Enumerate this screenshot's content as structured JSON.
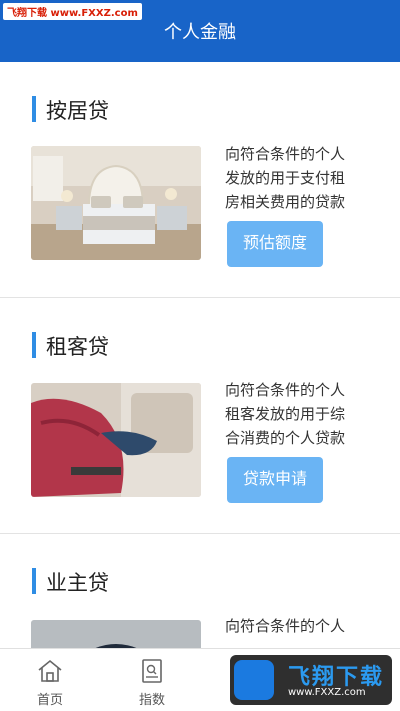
{
  "watermark": {
    "top_text": "飞翔下载 www.FXXZ.com",
    "bottom_name": "飞翔下载",
    "bottom_url": "www.FXXZ.com"
  },
  "header": {
    "title": "个人金融"
  },
  "sections": [
    {
      "title": "按居贷",
      "description_lines": [
        "向符合条件的个人",
        "发放的用于支付租",
        "房相关费用的贷款"
      ],
      "button_label": "预估额度"
    },
    {
      "title": "租客贷",
      "description_lines": [
        "向符合条件的个人",
        "租客发放的用于综",
        "合消费的个人贷款"
      ],
      "button_label": "贷款申请"
    },
    {
      "title": "业主贷",
      "description_lines": [
        "向符合条件的个人"
      ]
    }
  ],
  "tabbar": {
    "items": [
      {
        "label": "首页",
        "icon": "home-icon"
      },
      {
        "label": "指数",
        "icon": "index-icon"
      }
    ]
  },
  "colors": {
    "header_bg": "#1864c8",
    "accent_bar": "#2f8de4",
    "button_bg": "#6ab4f4"
  }
}
